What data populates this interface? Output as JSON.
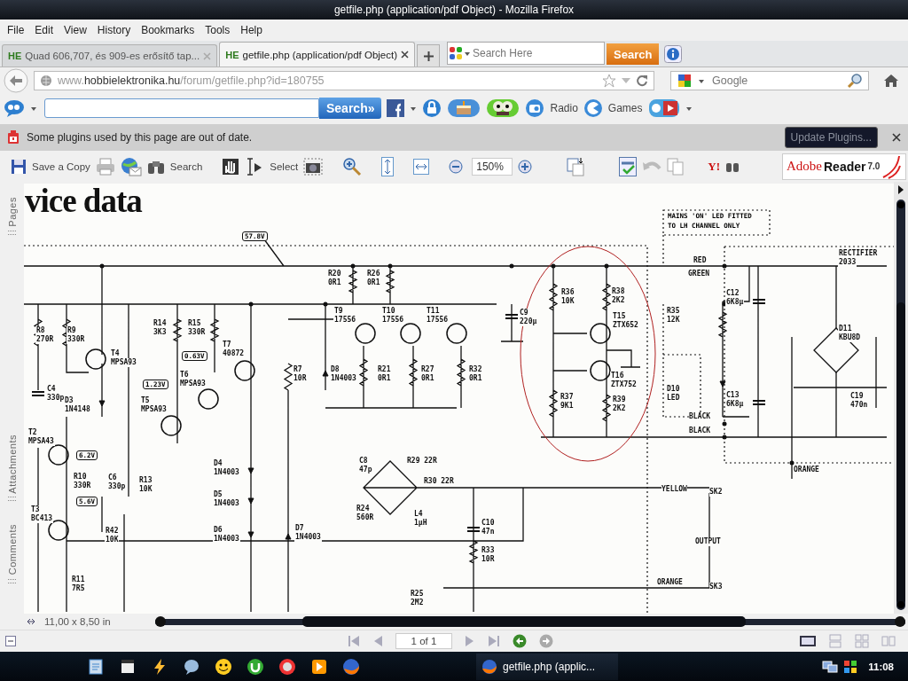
{
  "window": {
    "title": "getfile.php (application/pdf Object) - Mozilla Firefox"
  },
  "menu": [
    "File",
    "Edit",
    "View",
    "History",
    "Bookmarks",
    "Tools",
    "Help"
  ],
  "tabs": [
    {
      "favicon": "HE",
      "label": "Quad 606,707, és 909-es erősítő tap...",
      "selected": false
    },
    {
      "favicon": "HE",
      "label": "getfile.php (application/pdf Object)",
      "selected": true
    }
  ],
  "tab_search": {
    "placeholder": "Search Here",
    "button": "Search"
  },
  "address": {
    "url": "www.**hobbielektronika.hu**/forum/getfile.php?id=180755"
  },
  "web_search": {
    "placeholder": "Google"
  },
  "addon_toolbar": {
    "search_button": "Search»",
    "items": [
      "Radio",
      "Games"
    ]
  },
  "notification": {
    "message": "Some plugins used by this page are out of date.",
    "button": "Update Plugins..."
  },
  "reader_toolbar": {
    "save": "Save a Copy",
    "search": "Search",
    "select": "Select",
    "zoom": "150%",
    "yahoo": "Y!",
    "logo": [
      "Adobe",
      "Reader",
      "7.0"
    ]
  },
  "side_tabs": [
    "Pages",
    "Attachments",
    "Comments"
  ],
  "document": {
    "title": "vice data",
    "labels": [
      {
        "kind": "voltage",
        "ref": "57.8V"
      },
      {
        "kind": "part",
        "ref": "R20",
        "value": "0R1"
      },
      {
        "kind": "part",
        "ref": "R26",
        "value": "0R1"
      },
      {
        "kind": "part",
        "ref": "T9",
        "value": "17556"
      },
      {
        "kind": "part",
        "ref": "T10",
        "value": "17556"
      },
      {
        "kind": "part",
        "ref": "T11",
        "value": "17556"
      },
      {
        "kind": "part",
        "ref": "R8",
        "value": "270R"
      },
      {
        "kind": "part",
        "ref": "R9",
        "value": "330R"
      },
      {
        "kind": "part",
        "ref": "T4",
        "value": "MPSA93"
      },
      {
        "kind": "part",
        "ref": "R14",
        "value": "3K3"
      },
      {
        "kind": "part",
        "ref": "R15",
        "value": "330R"
      },
      {
        "kind": "part",
        "ref": "T7",
        "value": "40872"
      },
      {
        "kind": "voltage",
        "ref": "0.63V"
      },
      {
        "kind": "voltage",
        "ref": "1.23V"
      },
      {
        "kind": "part",
        "ref": "T6",
        "value": "MPSA93"
      },
      {
        "kind": "part",
        "ref": "T5",
        "value": "MPSA93"
      },
      {
        "kind": "part",
        "ref": "C4",
        "value": "330p"
      },
      {
        "kind": "part",
        "ref": "D3",
        "value": "1N4148"
      },
      {
        "kind": "part",
        "ref": "R7",
        "value": "10R"
      },
      {
        "kind": "part",
        "ref": "D8",
        "value": "1N4003"
      },
      {
        "kind": "part",
        "ref": "R21",
        "value": "0R1"
      },
      {
        "kind": "part",
        "ref": "R27",
        "value": "0R1"
      },
      {
        "kind": "part",
        "ref": "R32",
        "value": "0R1"
      },
      {
        "kind": "part",
        "ref": "C9",
        "value": "220μ"
      },
      {
        "kind": "part",
        "ref": "R36",
        "value": "10K"
      },
      {
        "kind": "part",
        "ref": "R38",
        "value": "2K2"
      },
      {
        "kind": "part",
        "ref": "T15",
        "value": "ZTX652"
      },
      {
        "kind": "part",
        "ref": "T16",
        "value": "ZTX752"
      },
      {
        "kind": "part",
        "ref": "R37",
        "value": "9K1"
      },
      {
        "kind": "part",
        "ref": "R39",
        "value": "2K2"
      },
      {
        "kind": "note",
        "ref": "MAINS 'ON' LED FITTED",
        "value": "TO LH CHANNEL ONLY"
      },
      {
        "kind": "wire",
        "ref": "RED"
      },
      {
        "kind": "part",
        "ref": "RECTIFIER",
        "value": "2033"
      },
      {
        "kind": "wire",
        "ref": "GREEN"
      },
      {
        "kind": "part",
        "ref": "R35",
        "value": "12K"
      },
      {
        "kind": "part",
        "ref": "C12",
        "value": "6K8μ"
      },
      {
        "kind": "part",
        "ref": "D11",
        "value": "KBU8D"
      },
      {
        "kind": "part",
        "ref": "D10",
        "value": "LED"
      },
      {
        "kind": "part",
        "ref": "C13",
        "value": "6K8μ"
      },
      {
        "kind": "part",
        "ref": "C19",
        "value": "470n"
      },
      {
        "kind": "wire",
        "ref": "BLACK"
      },
      {
        "kind": "wire",
        "ref": "BLACK"
      },
      {
        "kind": "wire",
        "ref": "ORANGE"
      },
      {
        "kind": "part",
        "ref": "T2",
        "value": "MPSA43"
      },
      {
        "kind": "voltage",
        "ref": "6.2V"
      },
      {
        "kind": "part",
        "ref": "R10",
        "value": "330R"
      },
      {
        "kind": "part",
        "ref": "C6",
        "value": "330p"
      },
      {
        "kind": "part",
        "ref": "R13",
        "value": "10K"
      },
      {
        "kind": "voltage",
        "ref": "5.6V"
      },
      {
        "kind": "part",
        "ref": "T3",
        "value": "BC413"
      },
      {
        "kind": "part",
        "ref": "R42",
        "value": "10K"
      },
      {
        "kind": "part",
        "ref": "R11",
        "value": "7R5"
      },
      {
        "kind": "part",
        "ref": "D4",
        "value": "1N4003"
      },
      {
        "kind": "part",
        "ref": "D5",
        "value": "1N4003"
      },
      {
        "kind": "part",
        "ref": "D6",
        "value": "1N4003"
      },
      {
        "kind": "part",
        "ref": "D7",
        "value": "1N4003"
      },
      {
        "kind": "part",
        "ref": "C8",
        "value": "47p"
      },
      {
        "kind": "wire",
        "ref": "R29 22R"
      },
      {
        "kind": "wire",
        "ref": "R30 22R"
      },
      {
        "kind": "part",
        "ref": "R24",
        "value": "560R"
      },
      {
        "kind": "part",
        "ref": "L4",
        "value": "1μH"
      },
      {
        "kind": "part",
        "ref": "C10",
        "value": "47n"
      },
      {
        "kind": "part",
        "ref": "R33",
        "value": "10R"
      },
      {
        "kind": "part",
        "ref": "R25",
        "value": "2M2"
      },
      {
        "kind": "wire",
        "ref": "YELLOW"
      },
      {
        "kind": "wire",
        "ref": "SK2"
      },
      {
        "kind": "wire",
        "ref": "OUTPUT"
      },
      {
        "kind": "wire",
        "ref": "ORANGE"
      },
      {
        "kind": "wire",
        "ref": "SK3"
      }
    ]
  },
  "status": {
    "page_size": "11,00 x 8,50 in",
    "page": "1 of 1"
  },
  "taskbar": {
    "task": "getfile.php (applic...",
    "clock": "11:08"
  }
}
